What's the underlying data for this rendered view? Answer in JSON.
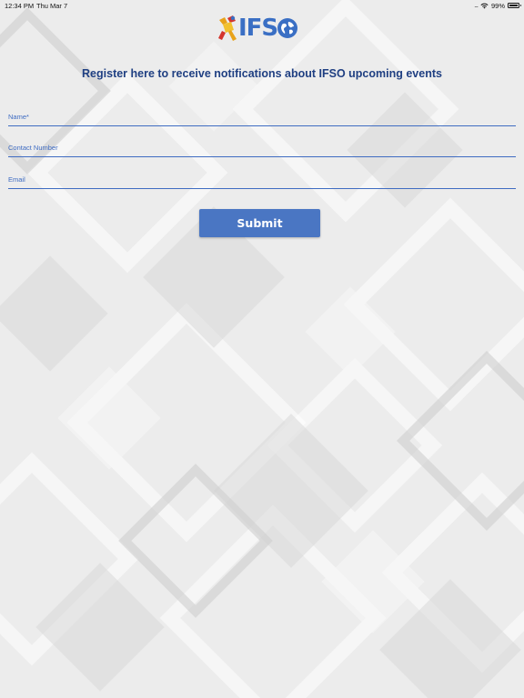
{
  "status_bar": {
    "time": "12:34 PM",
    "date": "Thu Mar 7",
    "signal": "....",
    "battery_percent": "99%",
    "battery_level": 0.99
  },
  "logo": {
    "text": "IFS"
  },
  "heading": "Register here to receive notifications about IFSO upcoming events",
  "form": {
    "name_label": "Name*",
    "contact_label": "Contact Number",
    "email_label": "Email",
    "submit_label": "Submit"
  },
  "colors": {
    "accent": "#3f6cc2",
    "button": "#4a76c3",
    "heading": "#1f3f82",
    "background": "#ececec"
  }
}
